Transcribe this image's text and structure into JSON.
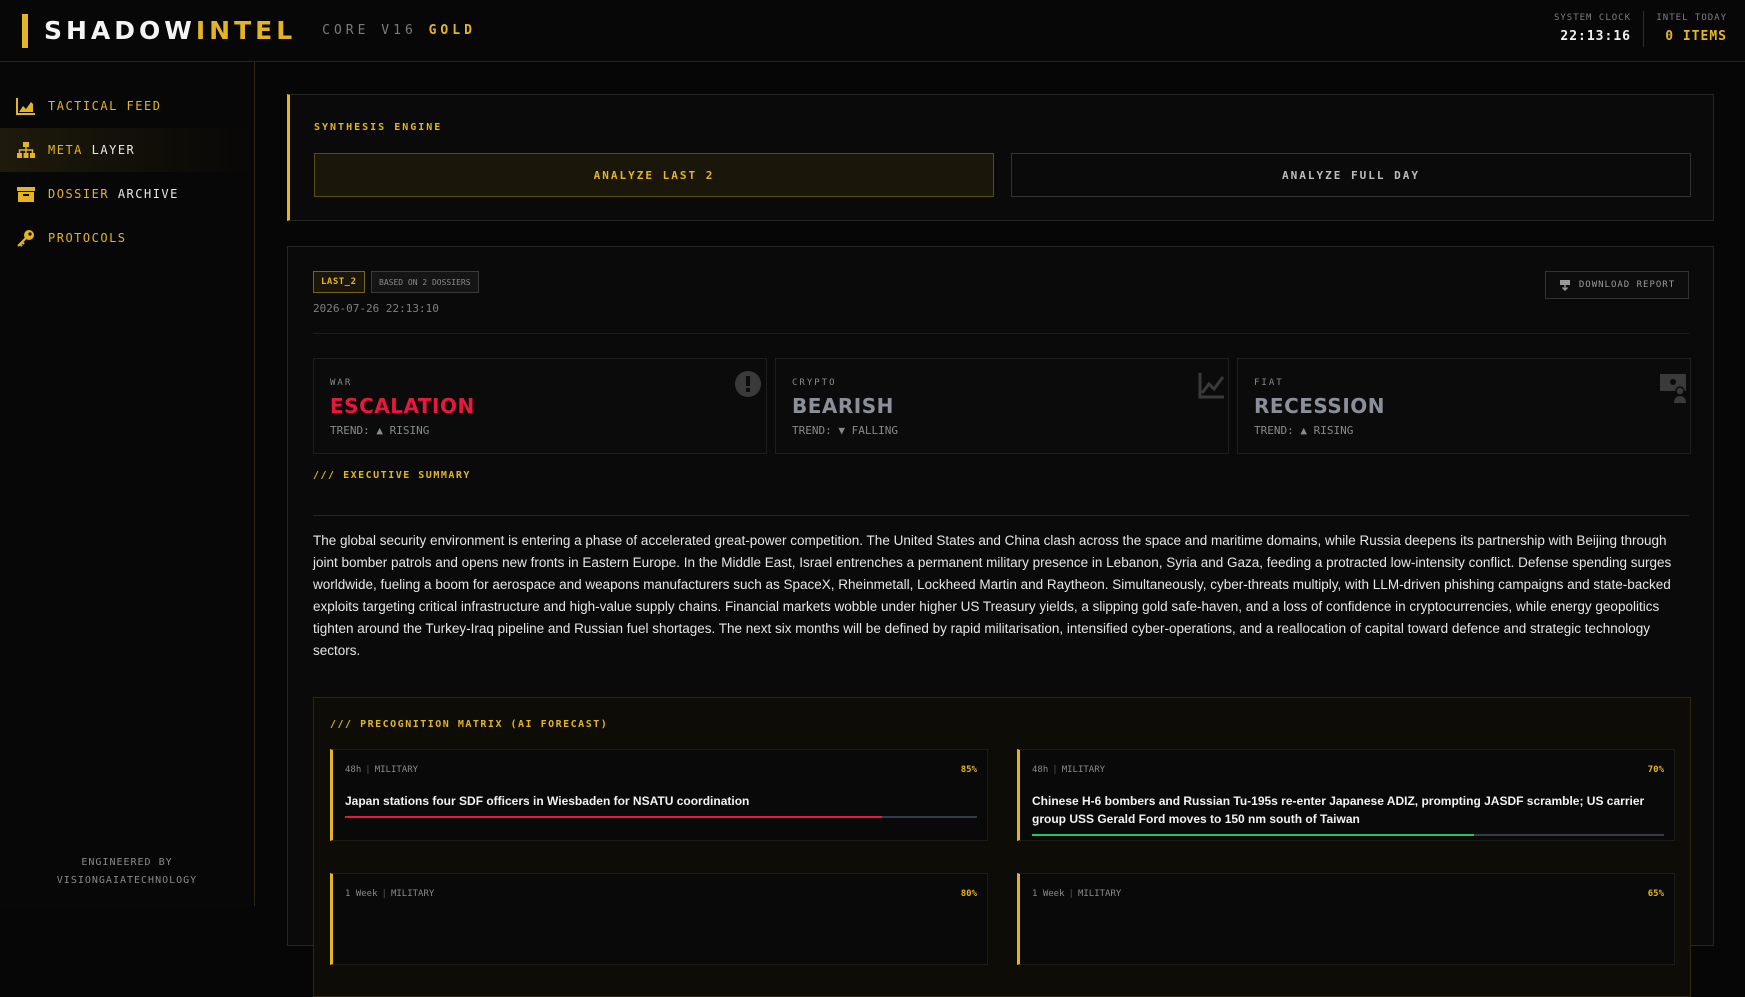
{
  "header": {
    "brand_main": "SHADOW",
    "brand_accent": "INTEL",
    "version_main": "CORE V16",
    "version_accent": "GOLD",
    "clock_label": "SYSTEM CLOCK",
    "clock_value": "22:13:16",
    "intel_label": "INTEL TODAY",
    "intel_value": "0 ITEMS"
  },
  "sidebar": {
    "items": [
      {
        "icon": "chart-area-icon",
        "label_a": "TACTICAL",
        "label_b": "FEED",
        "active": false
      },
      {
        "icon": "hierarchy-icon",
        "label_a": "META",
        "label_b": "LAYER",
        "active": true
      },
      {
        "icon": "archive-box-icon",
        "label_a": "DOSSIER",
        "label_b": "ARCHIVE",
        "active": false
      },
      {
        "icon": "key-icon",
        "label_a": "PROTOCOLS",
        "label_b": "",
        "active": false
      }
    ],
    "footer_line1": "ENGINEERED BY",
    "footer_line2": "VISIONGAIATECHNOLOGY"
  },
  "synthesis": {
    "title": "SYNTHESIS ENGINE",
    "btn_last": "ANALYZE LAST 2",
    "btn_full": "ANALYZE FULL DAY"
  },
  "report": {
    "badge": "LAST_2",
    "based_on": "BASED ON 2 DOSSIERS",
    "timestamp": "2026-07-26 22:13:10",
    "download": "DOWNLOAD REPORT",
    "metrics": [
      {
        "label": "WAR",
        "value": "ESCALATION",
        "trend": "TREND: ▲ RISING",
        "color": "#e8173c",
        "icon": "alert-circle-icon"
      },
      {
        "label": "CRYPTO",
        "value": "BEARISH",
        "trend": "TREND: ▼ FALLING",
        "color": "#8a8f99",
        "icon": "chart-line-icon"
      },
      {
        "label": "FIAT",
        "value": "RECESSION",
        "trend": "TREND: ▲ RISING",
        "color": "#8a8f99",
        "icon": "money-user-icon"
      }
    ],
    "summary_title": "/// EXECUTIVE SUMMARY",
    "summary": "The global security environment is entering a phase of accelerated great-power competition. The United States and China clash across the space and maritime domains, while Russia deepens its partnership with Beijing through joint bomber patrols and opens new fronts in Eastern Europe. In the Middle East, Israel entrenches a permanent military presence in Lebanon, Syria and Gaza, feeding a protracted low-intensity conflict. Defense spending surges worldwide, fueling a boom for aerospace and weapons manufacturers such as SpaceX, Rheinmetall, Lockheed Martin and Raytheon. Simultaneously, cyber-threats multiply, with LLM-driven phishing campaigns and state-backed exploits targeting critical infrastructure and high-value supply chains. Financial markets wobble under higher US Treasury yields, a slipping gold safe-haven, and a loss of confidence in cryptocurrencies, while energy geopolitics tighten around the Turkey-Iraq pipeline and Russian fuel shortages. The next six months will be defined by rapid militarisation, intensified cyber-operations, and a reallocation of capital toward defence and strategic technology sectors.",
    "matrix_title": "/// PRECOGNITION MATRIX (AI FORECAST)",
    "predictions": [
      {
        "horizon": "48h",
        "category": "MILITARY",
        "prob": "85%",
        "prob_value": 0.85,
        "title": "Japan stations four SDF officers in Wiesbaden for NSATU coordination",
        "bar_color": "#e8173c"
      },
      {
        "horizon": "48h",
        "category": "MILITARY",
        "prob": "70%",
        "prob_value": 0.7,
        "title": "Chinese H-6 bombers and Russian Tu-195s re-enter Japanese ADIZ, prompting JASDF scramble; US carrier group USS Gerald Ford moves to 150 nm south of Taiwan",
        "bar_color": "#22c55e"
      },
      {
        "horizon": "1 Week",
        "category": "MILITARY",
        "prob": "80%",
        "prob_value": 0.8,
        "title": "",
        "bar_color": "#e3b424"
      },
      {
        "horizon": "1 Week",
        "category": "MILITARY",
        "prob": "65%",
        "prob_value": 0.65,
        "title": "",
        "bar_color": "#e3b424"
      }
    ]
  }
}
